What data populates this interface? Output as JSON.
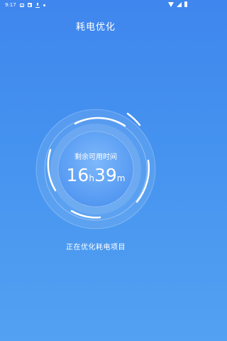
{
  "status_bar": {
    "time": "9:17",
    "left_icons": [
      "image-icon",
      "square-icon",
      "download-icon",
      "dot-icon"
    ],
    "right_icons": [
      "wifi-icon",
      "signal-icon",
      "battery-icon"
    ]
  },
  "header": {
    "title": "耗电优化"
  },
  "dial": {
    "label": "剩余可用时间",
    "hours": "16",
    "hours_unit": "h",
    "minutes": "39",
    "minutes_unit": "m"
  },
  "status": {
    "text": "正在优化耗电项目"
  },
  "colors": {
    "background_top": "#3f86ee",
    "background_bottom": "#53a1f2",
    "text": "#ffffff"
  }
}
